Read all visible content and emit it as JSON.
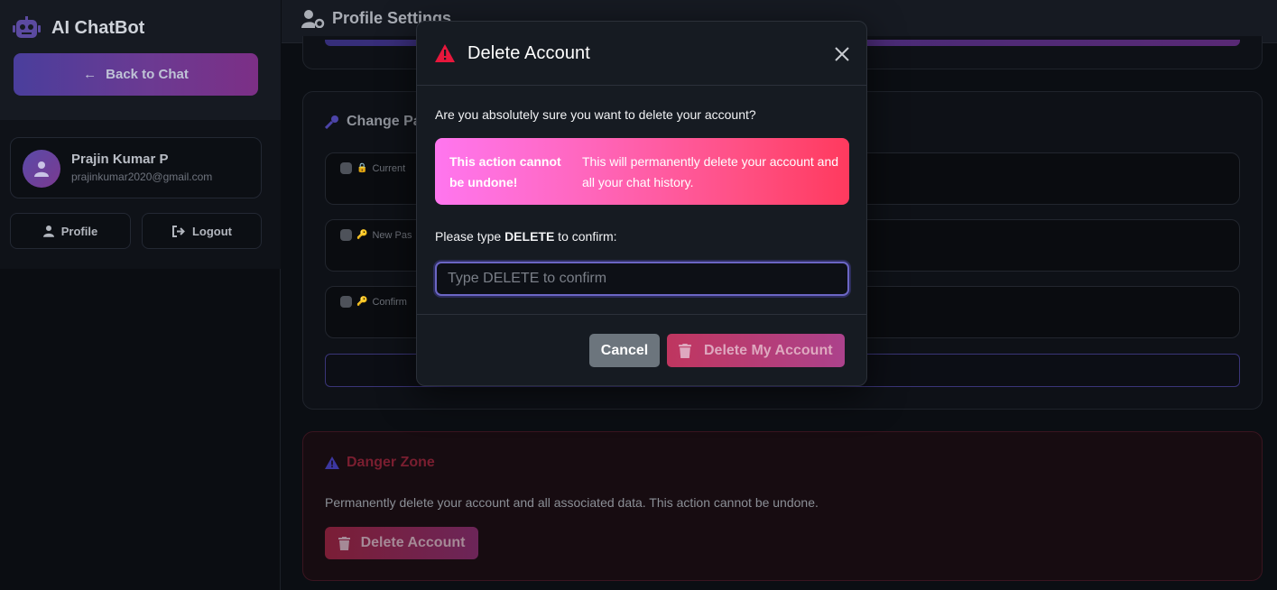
{
  "sidebar": {
    "brand_title": "AI ChatBot",
    "back_button": "Back to Chat",
    "user": {
      "name": "Prajin Kumar P",
      "email": "prajinkumar2020@gmail.com"
    },
    "profile_button": "Profile",
    "logout_button": "Logout"
  },
  "main": {
    "title": "Profile Settings",
    "change_password": {
      "title": "Change Pa",
      "fields": [
        {
          "label": "Current"
        },
        {
          "label": "New Pas"
        },
        {
          "label": "Confirm"
        }
      ]
    },
    "danger_zone": {
      "title": "Danger Zone",
      "description": "Permanently delete your account and all associated data. This action cannot be undone.",
      "button": "Delete Account"
    }
  },
  "modal": {
    "title": "Delete Account",
    "question": "Are you absolutely sure you want to delete your account?",
    "alert_strong": "This action cannot be undone!",
    "alert_text": "This will permanently delete your account and all your chat history.",
    "confirm_prefix": "Please type ",
    "confirm_keyword": "DELETE",
    "confirm_suffix": " to confirm:",
    "input_value": "",
    "input_placeholder": "Type DELETE to confirm",
    "cancel_button": "Cancel",
    "delete_button": "Delete My Account"
  },
  "colors": {
    "accent": "#6b66c4",
    "danger": "#ff3a5e",
    "warning_icon": "#e8173c"
  }
}
